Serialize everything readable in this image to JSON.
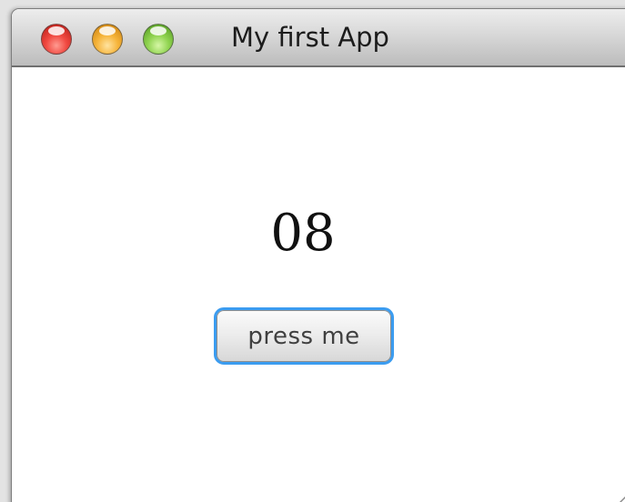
{
  "window": {
    "title": "My first App",
    "counter_value": "08",
    "button_label": "press me"
  },
  "controls": {
    "traffic_lights": [
      "close",
      "minimize",
      "zoom"
    ]
  },
  "colors": {
    "close": "#f14a42",
    "minimize": "#f6b43a",
    "zoom": "#8fd34f",
    "focus_ring": "#3b9cf0"
  },
  "icons": {
    "resize_grip": "resize-grip-icon"
  }
}
